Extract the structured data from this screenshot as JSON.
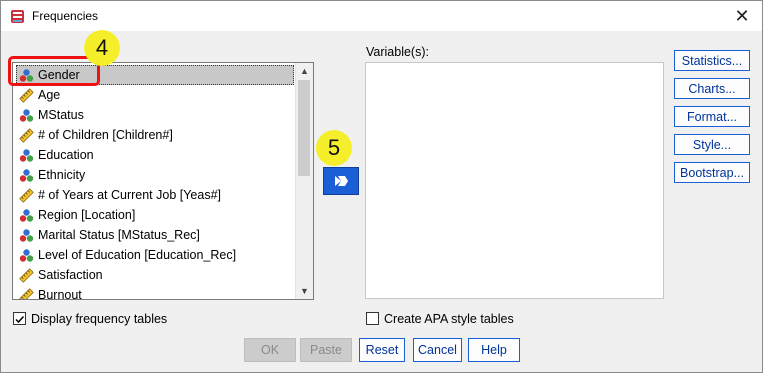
{
  "window": {
    "title": "Frequencies",
    "close_glyph": "✕"
  },
  "variables_list": {
    "items": [
      {
        "label": "Gender",
        "icon": "nominal-icon",
        "selected": true
      },
      {
        "label": "Age",
        "icon": "scale-ruler-icon"
      },
      {
        "label": "MStatus",
        "icon": "nominal-icon"
      },
      {
        "label": "# of Children [Children#]",
        "icon": "scale-ruler-icon"
      },
      {
        "label": "Education",
        "icon": "nominal-icon"
      },
      {
        "label": "Ethnicity",
        "icon": "nominal-icon"
      },
      {
        "label": "# of Years at Current Job [Yeas#]",
        "icon": "scale-ruler-icon"
      },
      {
        "label": "Region [Location]",
        "icon": "nominal-icon"
      },
      {
        "label": "Marital Status [MStatus_Rec]",
        "icon": "nominal-icon"
      },
      {
        "label": "Level of Education [Education_Rec]",
        "icon": "nominal-icon"
      },
      {
        "label": "Satisfaction",
        "icon": "scale-ruler-icon"
      },
      {
        "label": "Burnout",
        "icon": "scale-ruler-icon"
      }
    ]
  },
  "target_list": {
    "label": "Variable(s):",
    "items": []
  },
  "side_buttons": {
    "statistics": "Statistics...",
    "charts": "Charts...",
    "format": "Format...",
    "style": "Style...",
    "bootstrap": "Bootstrap..."
  },
  "checkboxes": {
    "display_frequency": {
      "label": "Display frequency tables",
      "checked": true
    },
    "apa_style": {
      "label": "Create APA style tables",
      "checked": false
    }
  },
  "bottom_buttons": {
    "ok": "OK",
    "paste": "Paste",
    "reset": "Reset",
    "cancel": "Cancel",
    "help": "Help"
  },
  "annotations": {
    "step4": "4",
    "step5": "5"
  },
  "colors": {
    "accent": "#1a5fd6",
    "highlight": "#e11111",
    "badge": "#f5ef2b"
  }
}
